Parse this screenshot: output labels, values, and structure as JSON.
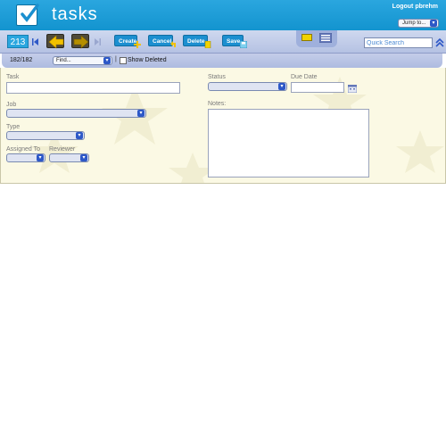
{
  "header": {
    "app_title": "tasks",
    "logout_label": "Logout pbrehm",
    "jump_select": {
      "selected": "Jump to...",
      "arrow": "▾"
    }
  },
  "toolbar": {
    "record_number": "213",
    "create_label": "Create",
    "cancel_label": "Cancel",
    "delete_label": "Delete",
    "save_label": "Save",
    "quick_search_placeholder": "Quick Search"
  },
  "infobar": {
    "record_count": "182/182",
    "find_select": {
      "selected": "Find...",
      "arrow": "▾"
    },
    "separator": "|",
    "show_deleted_label": "Show Deleted",
    "show_deleted_checked": false
  },
  "form": {
    "task_label": "Task",
    "task_value": "",
    "job_label": "Job",
    "job_value": "",
    "type_label": "Type",
    "type_value": "",
    "assigned_to_label": "Assigned To",
    "assigned_to_value": "",
    "reviewer_label": "Reviewer",
    "reviewer_value": "",
    "status_label": "Status",
    "status_value": "",
    "due_date_label": "Due Date",
    "due_date_value": "",
    "notes_label": "Notes:",
    "notes_value": "",
    "select_arrow": "▾"
  },
  "colors": {
    "header_blue": "#1a9cd8",
    "toolbar_lavender": "#c3cce9",
    "form_background": "#fbf9e4",
    "button_blue": "#1c8fd0",
    "accent_yellow": "#f2d300"
  },
  "icons": {
    "logo": "checkmark-icon",
    "first": "first-record-icon",
    "prev": "arrow-left-icon",
    "next": "arrow-right-icon",
    "last": "last-record-icon",
    "single_view": "single-record-view-icon",
    "list_view": "list-view-icon",
    "collapse": "double-chevron-up-icon",
    "calendar": "calendar-icon"
  }
}
